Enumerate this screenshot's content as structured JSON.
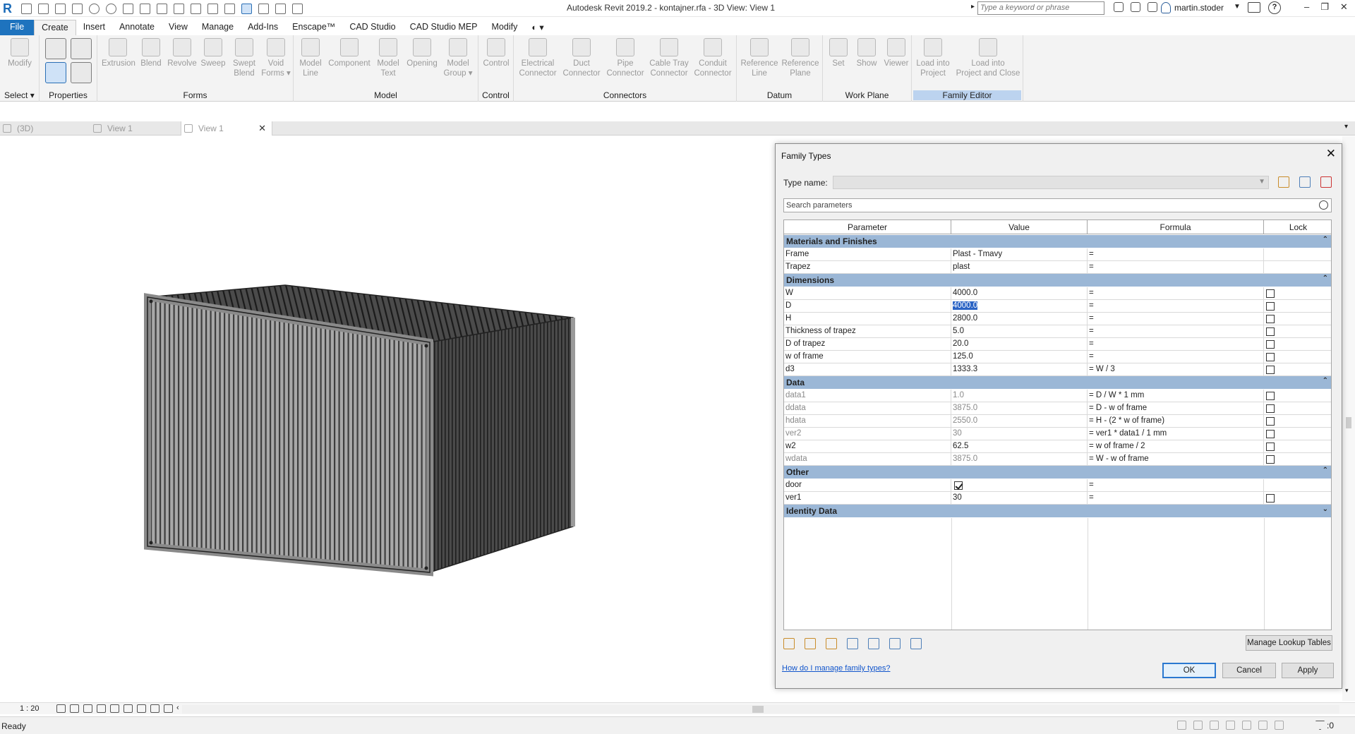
{
  "app": {
    "title": "Autodesk Revit 2019.2 - kontajner.rfa - 3D View: View 1",
    "search_placeholder": "Type a keyword or phrase",
    "user": "martin.stoder",
    "help": "?"
  },
  "ribbon_tabs": [
    "File",
    "Create",
    "Insert",
    "Annotate",
    "View",
    "Manage",
    "Add-Ins",
    "Enscape™",
    "CAD Studio",
    "CAD Studio MEP",
    "Modify"
  ],
  "ribbon": {
    "select_label": "Select",
    "groups": {
      "select": {
        "modify": "Modify"
      },
      "properties": {
        "title": "Properties"
      },
      "forms": {
        "title": "Forms",
        "extrusion": "Extrusion",
        "blend": "Blend",
        "revolve": "Revolve",
        "sweep": "Sweep",
        "swept_blend_1": "Swept",
        "swept_blend_2": "Blend",
        "void_1": "Void",
        "void_2": "Forms"
      },
      "model": {
        "title": "Model",
        "model_line_1": "Model",
        "model_line_2": "Line",
        "component": "Component",
        "model_text_1": "Model",
        "model_text_2": "Text",
        "opening": "Opening",
        "model_group_1": "Model",
        "model_group_2": "Group"
      },
      "control": {
        "title": "Control",
        "control": "Control"
      },
      "connectors": {
        "title": "Connectors",
        "elec_1": "Electrical",
        "elec_2": "Connector",
        "duct_1": "Duct",
        "duct_2": "Connector",
        "pipe_1": "Pipe",
        "pipe_2": "Connector",
        "cable_1": "Cable Tray",
        "cable_2": "Connector",
        "conduit_1": "Conduit",
        "conduit_2": "Connector"
      },
      "datum": {
        "title": "Datum",
        "refline_1": "Reference",
        "refline_2": "Line",
        "refplane_1": "Reference",
        "refplane_2": "Plane"
      },
      "work_plane": {
        "title": "Work Plane",
        "set": "Set",
        "show": "Show",
        "viewer": "Viewer"
      },
      "family_editor": {
        "title": "Family Editor",
        "load_1": "Load into",
        "load_2": "Project",
        "loadclose_1": "Load into",
        "loadclose_2": "Project and Close"
      }
    }
  },
  "view_tabs": [
    "(3D)",
    "View 1",
    "View 1"
  ],
  "status": {
    "scale": "1 : 20",
    "text": "Ready",
    "filter_count": ":0"
  },
  "dialog": {
    "title": "Family Types",
    "type_name_label": "Type name:",
    "search_placeholder": "Search parameters",
    "columns": [
      "Parameter",
      "Value",
      "Formula",
      "Lock"
    ],
    "groups": [
      {
        "name": "Materials and Finishes",
        "rows": [
          {
            "param": "Frame",
            "value": "Plast - Tmavy",
            "formula": "=",
            "lock": null
          },
          {
            "param": "Trapez",
            "value": "plast",
            "formula": "=",
            "lock": null
          }
        ]
      },
      {
        "name": "Dimensions",
        "rows": [
          {
            "param": "W",
            "value": "4000.0",
            "formula": "=",
            "lock": false
          },
          {
            "param": "D",
            "value": "4000.0",
            "formula": "=",
            "lock": false,
            "selected": true
          },
          {
            "param": "H",
            "value": "2800.0",
            "formula": "=",
            "lock": false
          },
          {
            "param": "Thickness of trapez",
            "value": "5.0",
            "formula": "=",
            "lock": false
          },
          {
            "param": "D of trapez",
            "value": "20.0",
            "formula": "=",
            "lock": false
          },
          {
            "param": "w of frame",
            "value": "125.0",
            "formula": "=",
            "lock": false
          },
          {
            "param": "d3",
            "value": "1333.3",
            "formula": "= W / 3",
            "lock": false
          }
        ]
      },
      {
        "name": "Data",
        "rows": [
          {
            "param": "data1",
            "value": "1.0",
            "formula": "= D / W * 1 mm",
            "lock": false,
            "readonly": true
          },
          {
            "param": "ddata",
            "value": "3875.0",
            "formula": "= D - w of frame",
            "lock": false,
            "readonly": true
          },
          {
            "param": "hdata",
            "value": "2550.0",
            "formula": "= H - (2 * w of frame)",
            "lock": false,
            "readonly": true
          },
          {
            "param": "ver2",
            "value": "30",
            "formula": "= ver1 * data1 / 1 mm",
            "lock": false,
            "readonly": true
          },
          {
            "param": "w2",
            "value": "62.5",
            "formula": "= w of frame / 2",
            "lock": false
          },
          {
            "param": "wdata",
            "value": "3875.0",
            "formula": "= W - w of frame",
            "lock": false,
            "readonly": true
          }
        ]
      },
      {
        "name": "Other",
        "rows": [
          {
            "param": "door",
            "value": "",
            "value_checkbox": true,
            "formula": "=",
            "lock": null
          },
          {
            "param": "ver1",
            "value": "30",
            "formula": "=",
            "lock": false
          }
        ]
      },
      {
        "name": "Identity Data",
        "rows": []
      }
    ],
    "manage_lookup": "Manage Lookup Tables",
    "help_link": "How do I manage family types?",
    "ok": "OK",
    "cancel": "Cancel",
    "apply": "Apply"
  }
}
